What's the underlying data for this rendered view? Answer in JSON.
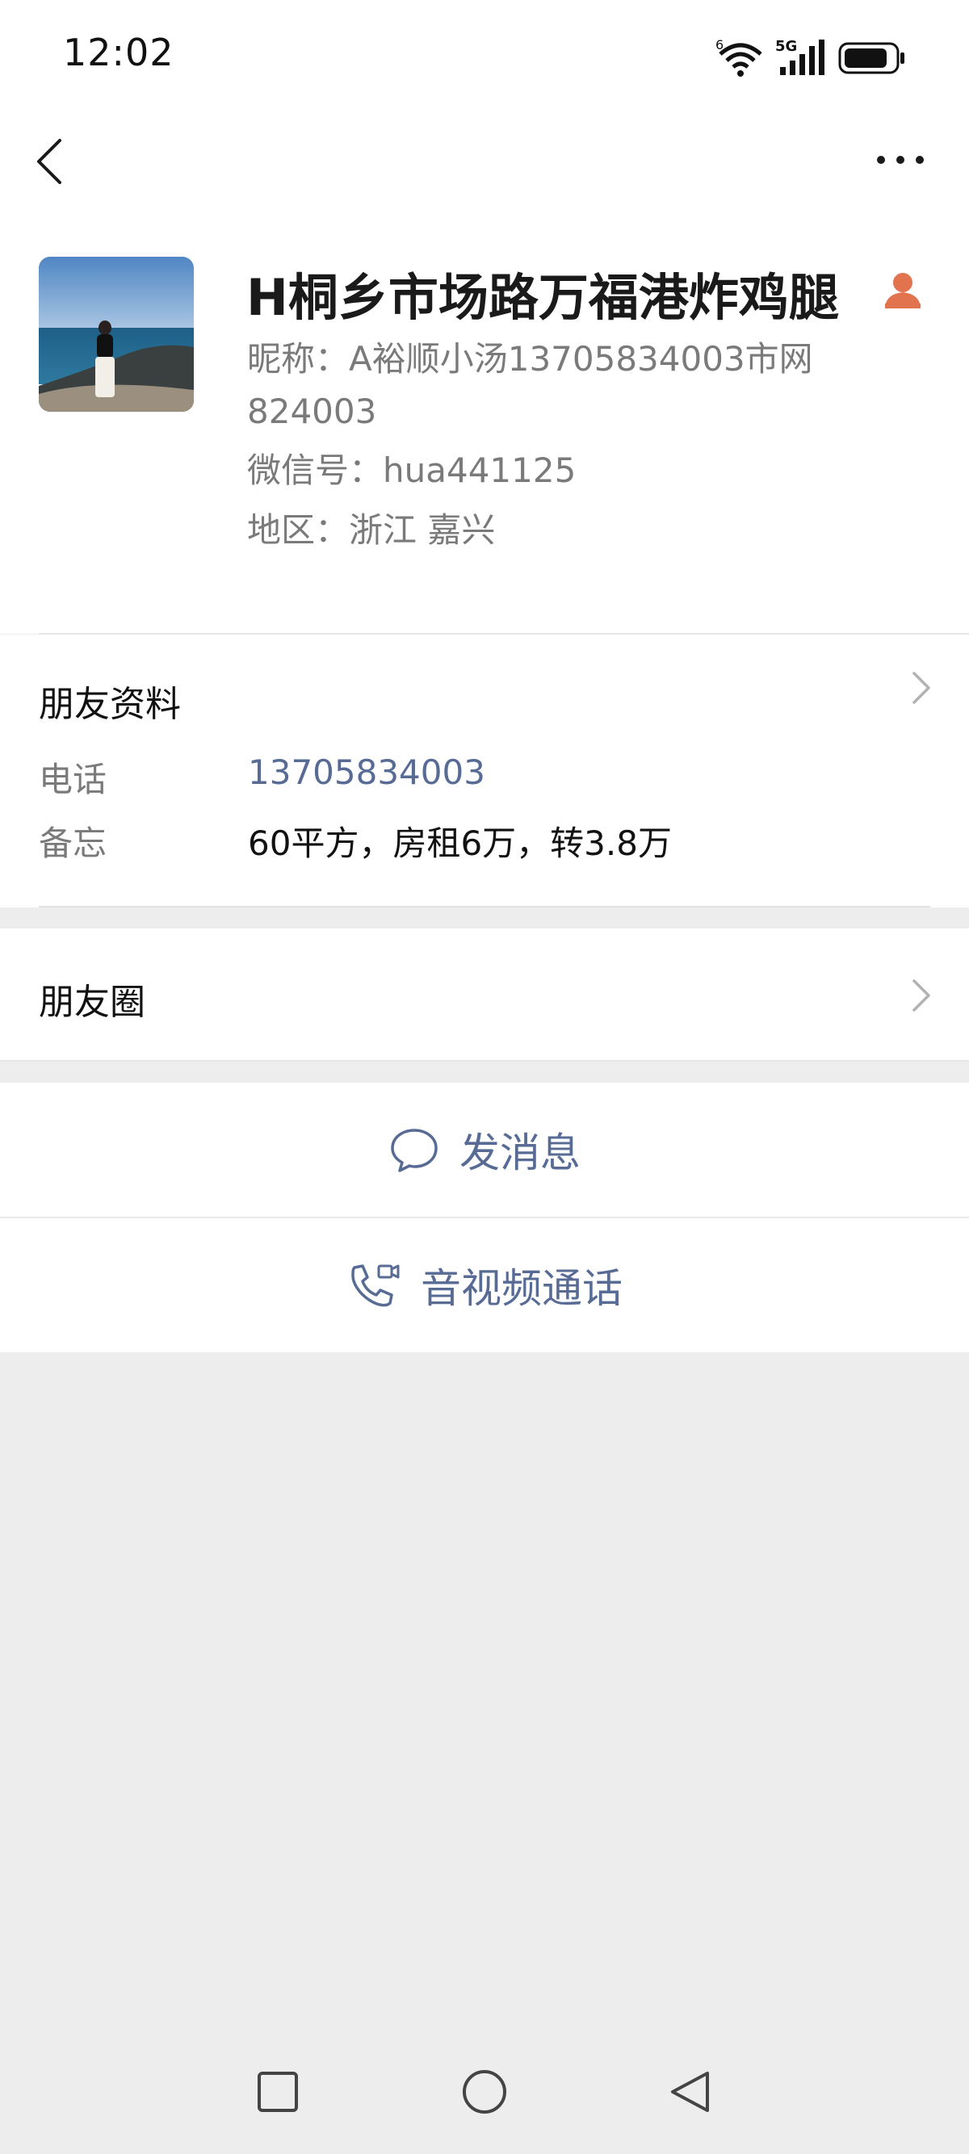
{
  "status_bar": {
    "time": "12:02",
    "wifi_badge": "6",
    "network_label": "5G"
  },
  "nav": {
    "back_icon": "chevron-left-icon",
    "more_icon": "more-dots-icon"
  },
  "profile": {
    "display_name": "H桐乡市场路万福港炸鸡腿",
    "nickname_line1": "昵称：A裕顺小汤13705834003市网",
    "nickname_line2": "824003",
    "wechat_id_line": "微信号：hua441125",
    "region_line": "地区：浙江  嘉兴",
    "contact_icon": "person-badge-icon",
    "accent_color": "#e2734f"
  },
  "friend_info": {
    "title": "朋友资料",
    "phone_label": "电话",
    "phone_value": "13705834003",
    "memo_label": "备忘",
    "memo_value": "60平方，房租6万，转3.8万"
  },
  "moments": {
    "title": "朋友圈"
  },
  "actions": {
    "message_label": "发消息",
    "call_label": "音视频通话",
    "link_color": "#576b95"
  }
}
